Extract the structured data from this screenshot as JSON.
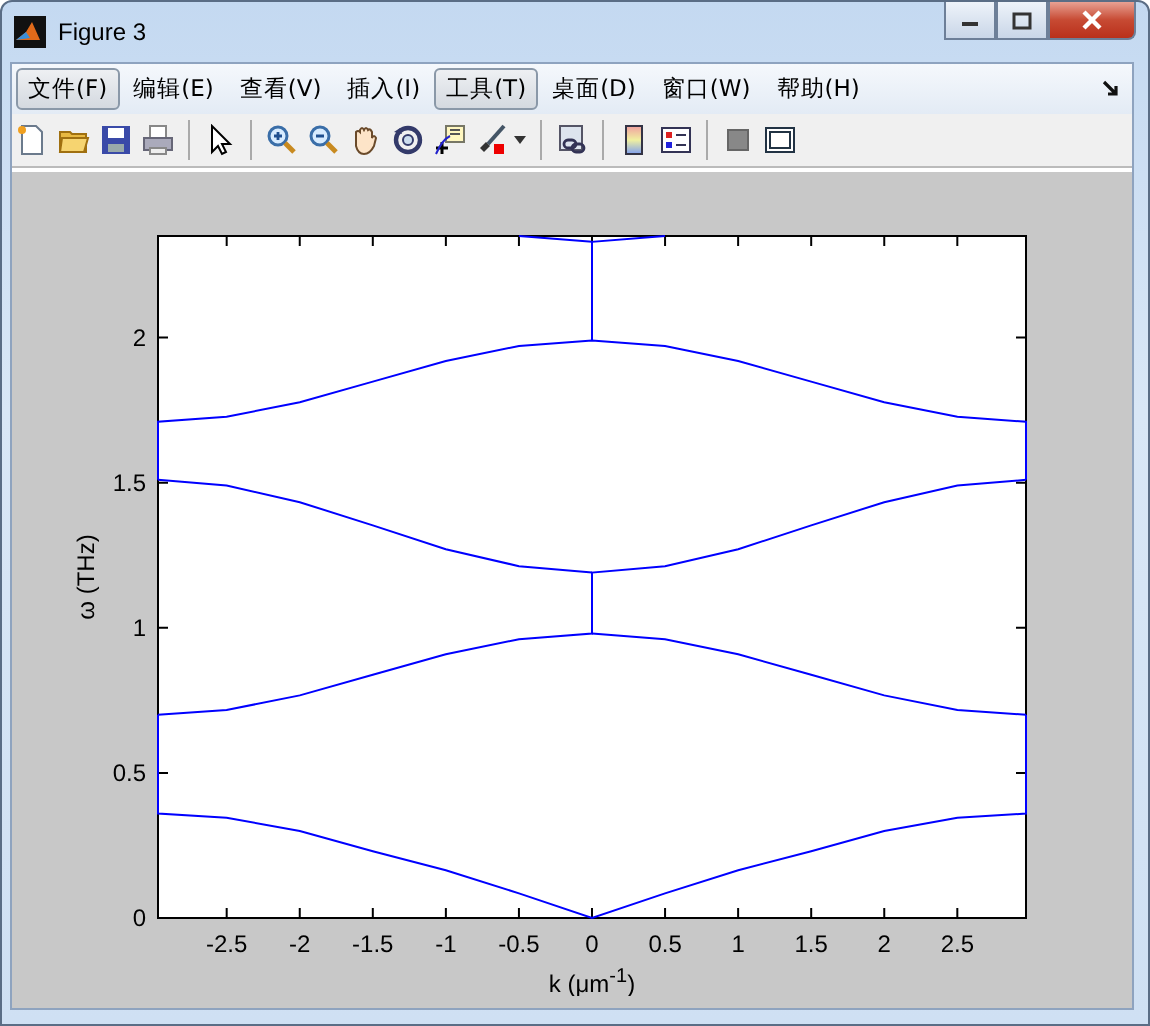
{
  "window": {
    "title": "Figure 3"
  },
  "menu": [
    {
      "label": "文件(F)",
      "highlighted": true
    },
    {
      "label": "编辑(E)",
      "highlighted": false
    },
    {
      "label": "查看(V)",
      "highlighted": false
    },
    {
      "label": "插入(I)",
      "highlighted": false
    },
    {
      "label": "工具(T)",
      "highlighted": true
    },
    {
      "label": "桌面(D)",
      "highlighted": false
    },
    {
      "label": "窗口(W)",
      "highlighted": false
    },
    {
      "label": "帮助(H)",
      "highlighted": false
    }
  ],
  "plot": {
    "chart_data": {
      "type": "line",
      "xlabel": "k (μm$^{-1}$)",
      "ylabel": "ω (THz)",
      "x": [
        -2.97,
        -2.97,
        -2.5,
        -2,
        -1.5,
        -1,
        -0.5,
        0,
        0,
        0.5,
        1,
        1.5,
        2,
        2.5,
        2.97,
        2.97
      ],
      "series": [
        {
          "color": "#0000ff",
          "values": [
            0.7,
            0.36,
            0.345,
            0.3,
            0.23,
            0.165,
            0.085,
            0,
            0,
            0.085,
            0.165,
            0.23,
            0.3,
            0.345,
            0.36,
            0.7
          ]
        },
        {
          "color": "#0000ff",
          "values": [
            null,
            0.7,
            0.717,
            0.767,
            0.838,
            0.909,
            0.961,
            0.98,
            1.19,
            1.212,
            1.271,
            1.353,
            1.433,
            1.49,
            1.51,
            null
          ]
        },
        {
          "color": "#0000ff",
          "values": [
            null,
            1.51,
            1.49,
            1.433,
            1.353,
            1.271,
            1.212,
            1.19,
            null,
            null,
            null,
            null,
            null,
            null,
            null,
            null
          ]
        },
        {
          "color": "#0000ff",
          "values": [
            null,
            null,
            null,
            null,
            null,
            null,
            null,
            null,
            0.98,
            0.961,
            0.909,
            0.838,
            0.767,
            0.717,
            0.7,
            null
          ]
        },
        {
          "color": "#0000ff",
          "values": [
            1.51,
            1.71,
            1.727,
            1.777,
            1.848,
            1.919,
            1.971,
            1.99,
            1.99,
            1.971,
            1.919,
            1.848,
            1.777,
            1.727,
            1.71,
            1.51
          ]
        },
        {
          "color": "#0000ff",
          "values": [
            null,
            null,
            null,
            null,
            null,
            null,
            null,
            1.99,
            2.33,
            2.35,
            null,
            null,
            null,
            null,
            null,
            null
          ]
        },
        {
          "color": "#0000ff",
          "values": [
            null,
            null,
            null,
            null,
            null,
            null,
            2.35,
            2.33,
            null,
            null,
            null,
            null,
            null,
            null,
            null,
            null
          ]
        }
      ],
      "xlim": [
        -2.97,
        2.97
      ],
      "ylim": [
        0,
        2.35
      ],
      "xticks": [
        -2.5,
        -2,
        -1.5,
        -1,
        -0.5,
        0,
        0.5,
        1,
        1.5,
        2,
        2.5
      ],
      "yticks": [
        0,
        0.5,
        1,
        1.5,
        2
      ]
    }
  }
}
